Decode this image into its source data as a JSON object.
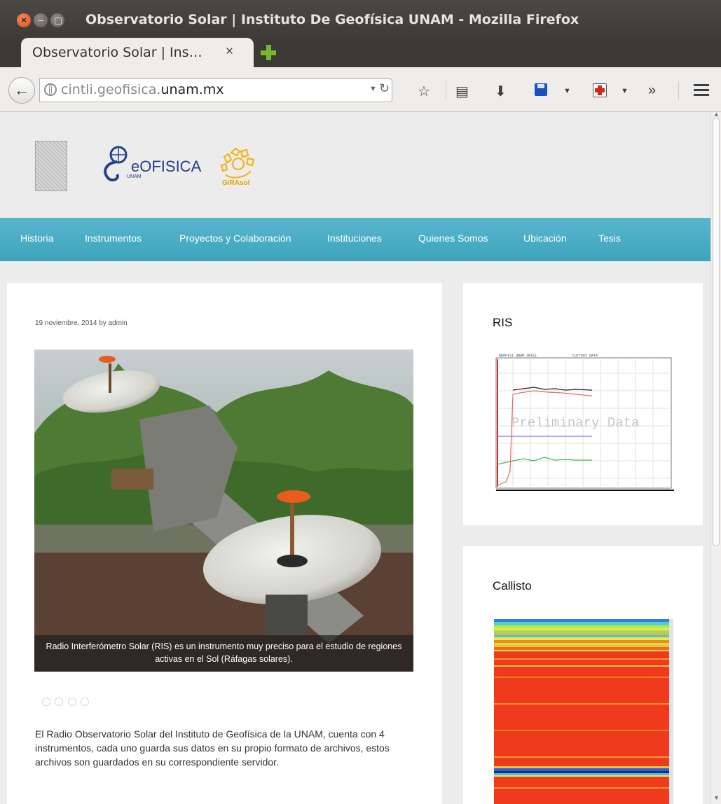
{
  "window": {
    "title": "Observatorio Solar | Instituto De Geofísica UNAM - Mozilla Firefox"
  },
  "tab": {
    "label": "Observatorio Solar | Ins…",
    "close": "×"
  },
  "toolbar": {
    "url_host_prefix": "cintli.geofisica.",
    "url_host_domain": "unam.mx",
    "icons": [
      "back-arrow-icon",
      "globe-icon",
      "reload-icon",
      "bookmark-star-icon",
      "reading-list-icon",
      "download-icon",
      "save-icon",
      "firstaid-icon",
      "overflow-chevron-icon",
      "hamburger-menu-icon"
    ]
  },
  "header": {
    "logo_geofisica_text": "eOFISICA",
    "logo_geofisica_sub": "UNAM",
    "logo_girasol_text": "GIRAsol"
  },
  "nav": {
    "items": [
      "Historia",
      "Instrumentos",
      "Proyectos y Colaboración",
      "Instituciones",
      "Quienes Somos",
      "Ubicación",
      "Tesis"
    ]
  },
  "post": {
    "meta": "19 noviembre, 2014 by admin",
    "caption": "Radio Interferómetro Solar (RIS) es un instrumento muy preciso para el estudio de regiones activas en el Sol (Ráfagas solares).",
    "body": "El Radio Observatorio Solar del Instituto de Geofísica de la UNAM, cuenta con 4 instrumentos, cada uno guarda sus datos en su propio formato de archivos, estos archivos son guardados en su correspondiente servidor."
  },
  "sidebar": {
    "widgets": [
      {
        "title": "RIS",
        "chart_header": "GEOFISi UNAM (RIS)",
        "chart_status": "Current DATA",
        "watermark": "Preliminary Data"
      },
      {
        "title": "Callisto"
      }
    ]
  },
  "colors": {
    "nav": "#48acc4",
    "caption_bg": "#1e1e1e",
    "accent_green": "#77b82a"
  }
}
